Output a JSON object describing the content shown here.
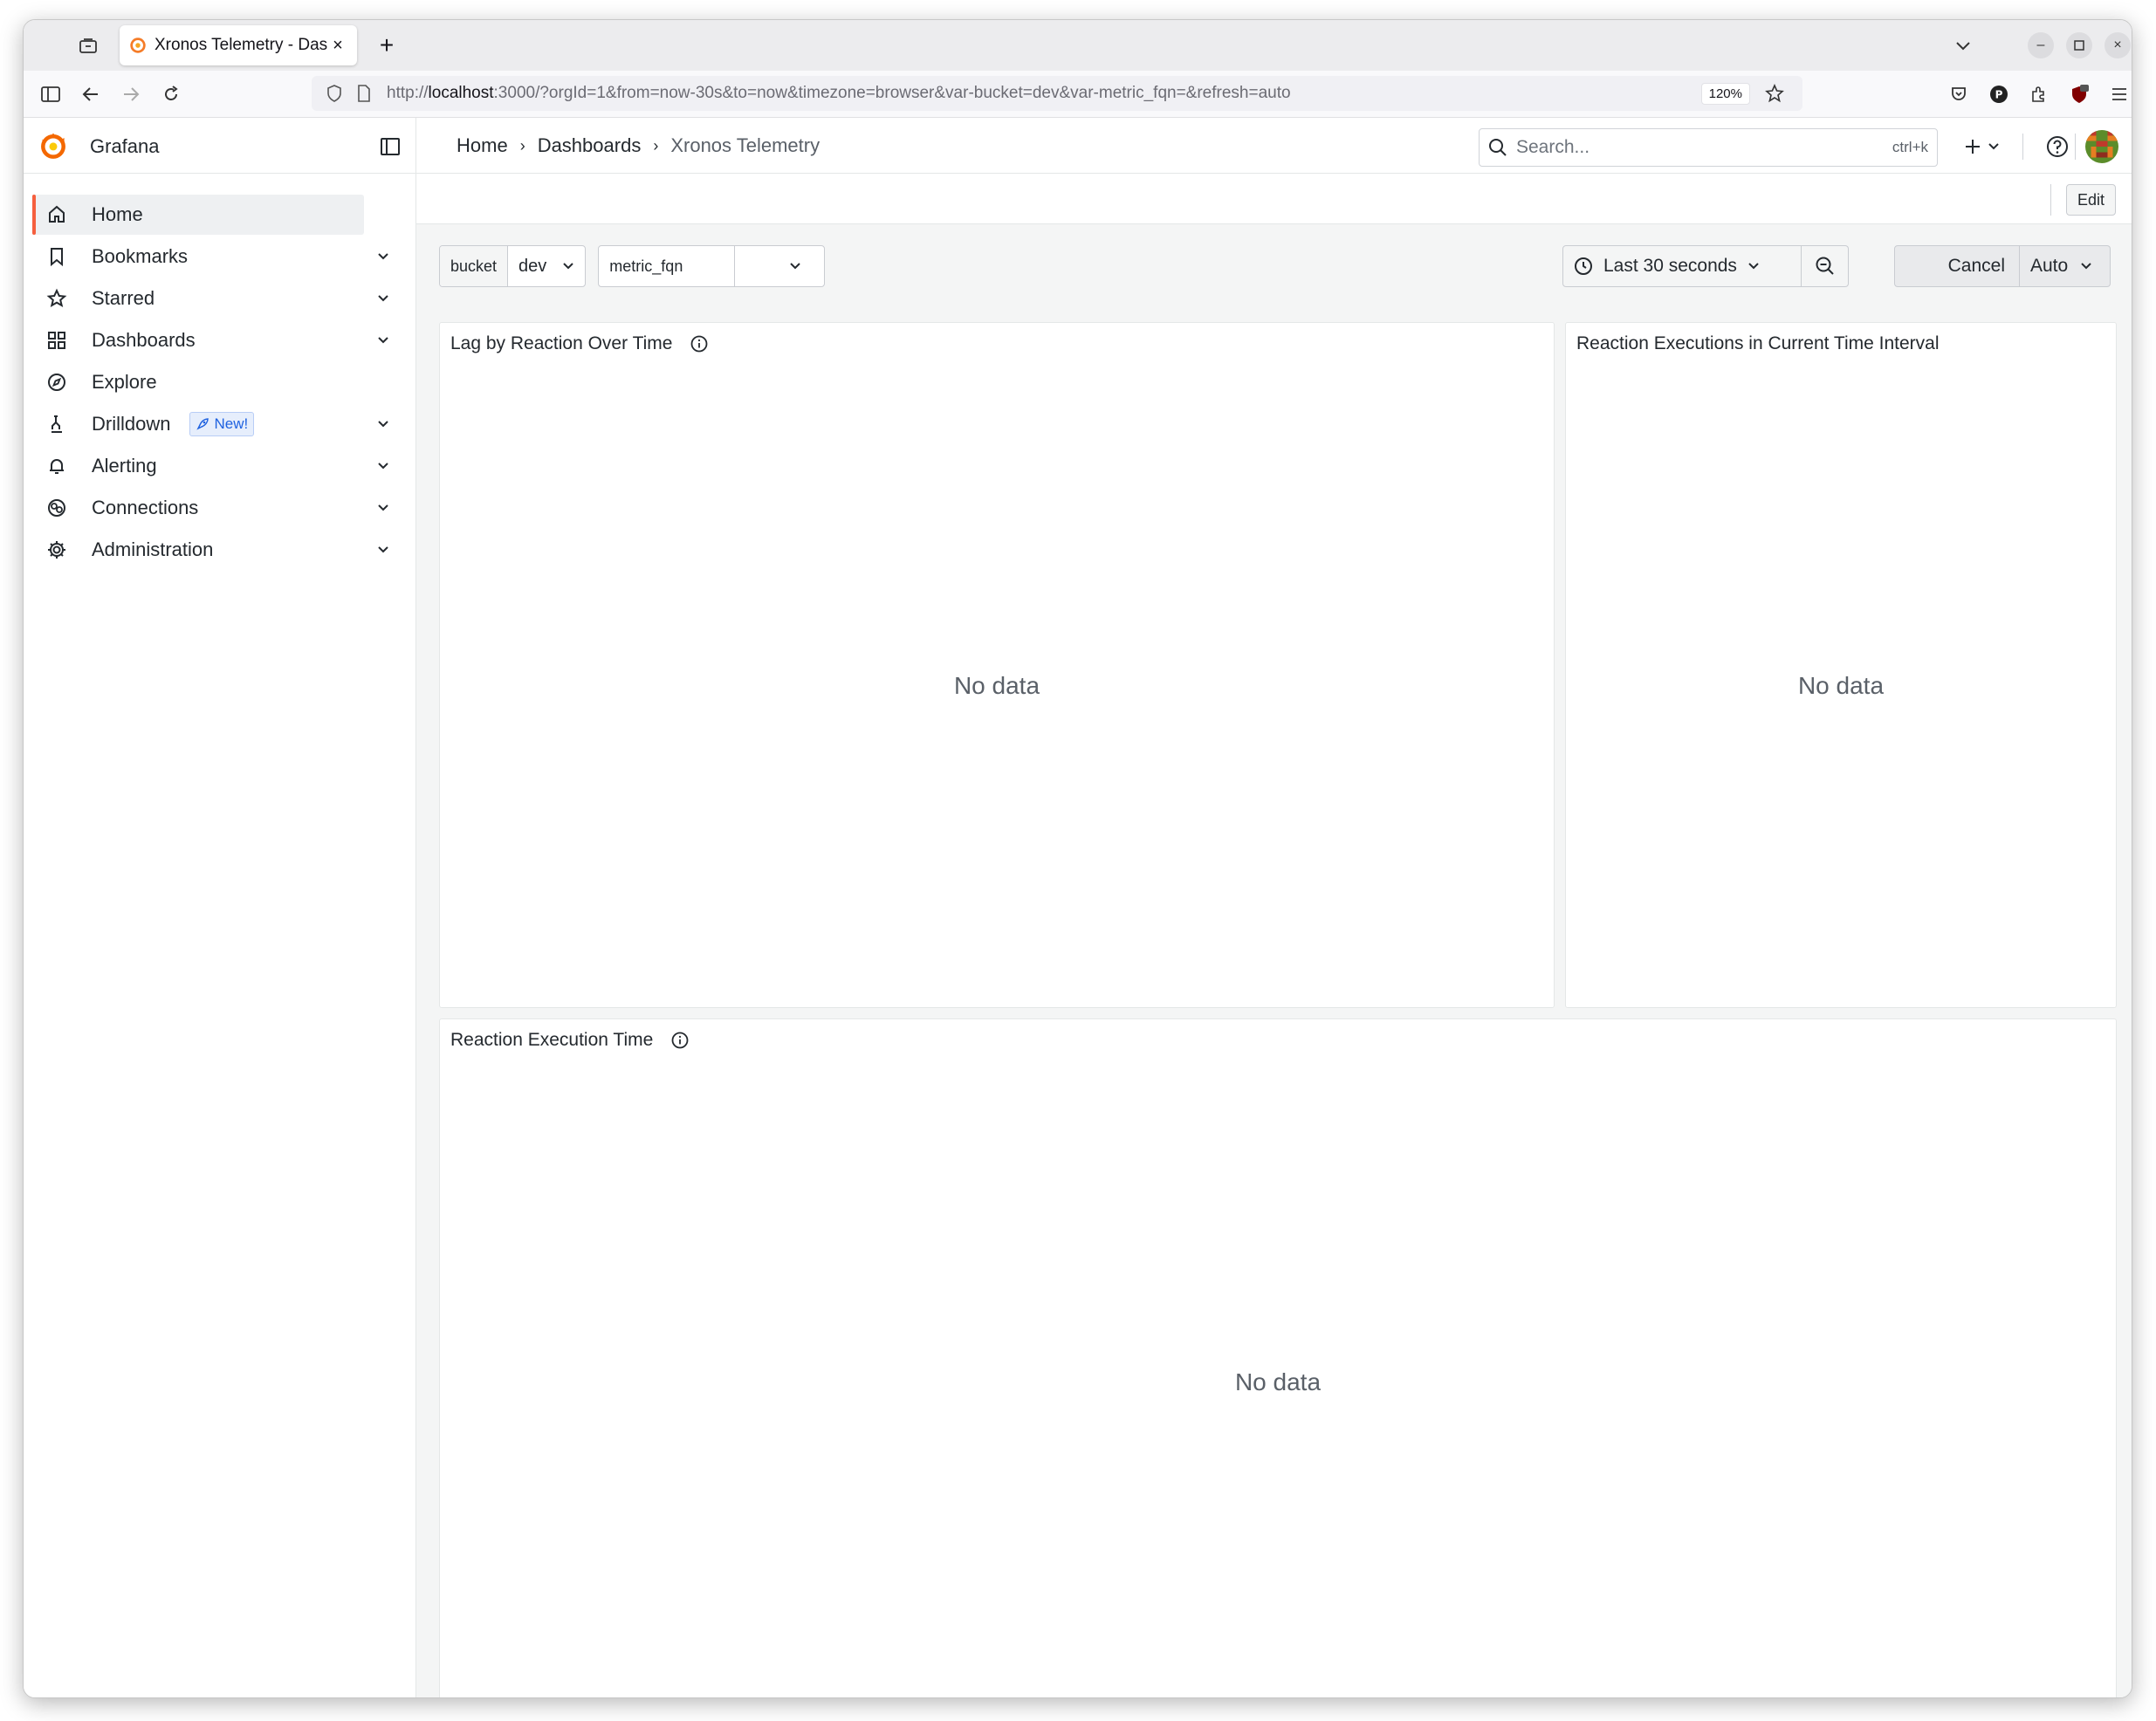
{
  "browser": {
    "tab_title": "Xronos Telemetry - Dashb",
    "url_prefix": "http://",
    "url_host": "localhost",
    "url_rest": ":3000/?orgId=1&from=now-30s&to=now&timezone=browser&var-bucket=dev&var-metric_fqn=&refresh=auto",
    "zoom": "120%"
  },
  "app": {
    "brand": "Grafana",
    "accent": "#f55f3e"
  },
  "breadcrumb": [
    "Home",
    "Dashboards",
    "Xronos Telemetry"
  ],
  "search": {
    "placeholder": "Search...",
    "shortcut": "ctrl+k"
  },
  "toolbar": {
    "edit_label": "Edit"
  },
  "sidebar": {
    "items": [
      {
        "label": "Home",
        "icon": "home-icon",
        "active": true
      },
      {
        "label": "Bookmarks",
        "icon": "bookmark-icon"
      },
      {
        "label": "Starred",
        "icon": "star-icon"
      },
      {
        "label": "Dashboards",
        "icon": "apps-icon"
      },
      {
        "label": "Explore",
        "icon": "compass-icon"
      },
      {
        "label": "Drilldown",
        "icon": "drilldown-icon",
        "badge": "New!"
      },
      {
        "label": "Alerting",
        "icon": "bell-icon"
      },
      {
        "label": "Connections",
        "icon": "connections-icon"
      },
      {
        "label": "Administration",
        "icon": "cog-icon"
      }
    ]
  },
  "variables": {
    "bucket": {
      "label": "bucket",
      "value": "dev"
    },
    "metric": {
      "label": "metric_fqn",
      "value": ""
    }
  },
  "time": {
    "range": "Last 30 seconds",
    "cancel": "Cancel",
    "refresh": "Auto"
  },
  "panels": [
    {
      "title": "Lag by Reaction Over Time",
      "message": "No data"
    },
    {
      "title": "Reaction Executions in Current Time Interval",
      "message": "No data"
    },
    {
      "title": "Reaction Execution Time",
      "message": "No data"
    }
  ]
}
